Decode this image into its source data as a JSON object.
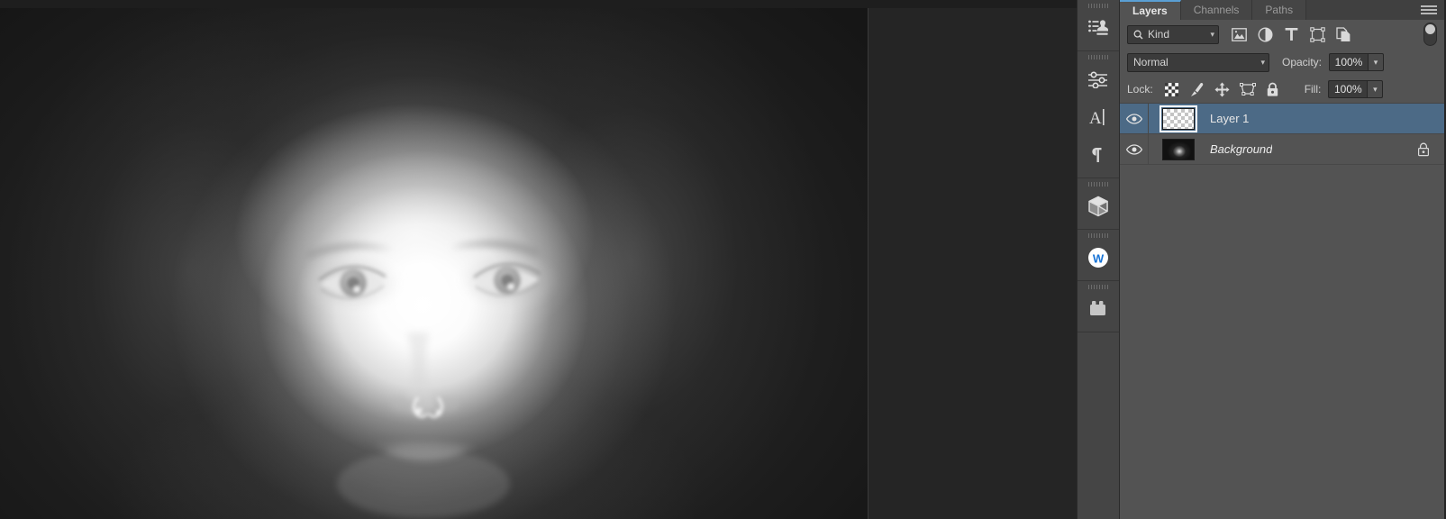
{
  "app": {
    "name": "Adobe Photoshop",
    "theme_bg": "#535353",
    "canvas_bg": "#252525",
    "accent": "#4c6a86"
  },
  "canvas": {
    "document_description": "Grayscale portrait of a hooded face, heavily overexposed / dodged in the center"
  },
  "icon_dock": {
    "groups": [
      {
        "items": [
          {
            "name": "libraries-icon",
            "label": "Libraries"
          }
        ]
      },
      {
        "items": [
          {
            "name": "adjustments-icon",
            "label": "Adjustments"
          },
          {
            "name": "character-icon",
            "label": "Character"
          },
          {
            "name": "paragraph-icon",
            "label": "Paragraph"
          }
        ]
      },
      {
        "items": [
          {
            "name": "3d-icon",
            "label": "3D"
          }
        ]
      },
      {
        "items": [
          {
            "name": "wacom-icon",
            "label": "W"
          }
        ]
      },
      {
        "items": [
          {
            "name": "plugins-icon",
            "label": "Plugins"
          }
        ]
      }
    ]
  },
  "panel": {
    "tabs": [
      {
        "label": "Layers",
        "active": true
      },
      {
        "label": "Channels",
        "active": false
      },
      {
        "label": "Paths",
        "active": false
      }
    ],
    "menu_label": "Panel menu",
    "filter_row": {
      "kind_label": "Kind",
      "search_icon": "magnifier-icon",
      "filters": [
        {
          "name": "filter-pixel-icon",
          "label": "Filter for pixel layers"
        },
        {
          "name": "filter-adjustment-icon",
          "label": "Filter for adjustment layers"
        },
        {
          "name": "filter-type-icon",
          "label": "Filter for type layers"
        },
        {
          "name": "filter-shape-icon",
          "label": "Filter for shape layers"
        },
        {
          "name": "filter-smartobject-icon",
          "label": "Filter for smart objects"
        }
      ],
      "toggle_label": "Turn layer filtering on/off"
    },
    "blend_row": {
      "blend_mode": "Normal",
      "opacity_label": "Opacity:",
      "opacity_value": "100%"
    },
    "lock_row": {
      "lock_label": "Lock:",
      "locks": [
        {
          "name": "lock-transparent-pixels-icon",
          "label": "Lock transparent pixels"
        },
        {
          "name": "lock-image-pixels-icon",
          "label": "Lock image pixels"
        },
        {
          "name": "lock-position-icon",
          "label": "Lock position"
        },
        {
          "name": "lock-artboard-icon",
          "label": "Prevent auto-nesting into and out of artboards"
        },
        {
          "name": "lock-all-icon",
          "label": "Lock all"
        }
      ],
      "fill_label": "Fill:",
      "fill_value": "100%"
    },
    "layers": [
      {
        "name": "Layer 1",
        "visible": true,
        "selected": true,
        "locked": false,
        "italic": false,
        "thumbnail": "transparent-checker"
      },
      {
        "name": "Background",
        "visible": true,
        "selected": false,
        "locked": true,
        "italic": true,
        "thumbnail": "portrait-photo"
      }
    ]
  }
}
